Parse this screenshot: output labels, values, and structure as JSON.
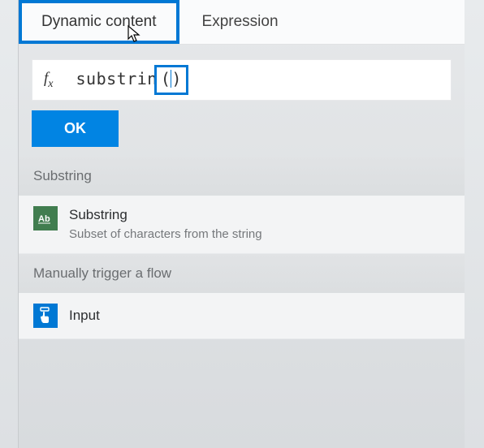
{
  "tabs": {
    "dynamic": "Dynamic content",
    "expression": "Expression"
  },
  "formula": {
    "prefix": "substrin",
    "inside": "()",
    "ok": "OK"
  },
  "sections": {
    "substring_header": "Substring",
    "substring_item_title": "Substring",
    "substring_item_desc": "Subset of characters from the string",
    "trigger_header": "Manually trigger a flow",
    "input_item_title": "Input"
  },
  "icons": {
    "substring": "Ab",
    "input": "input-hand"
  }
}
